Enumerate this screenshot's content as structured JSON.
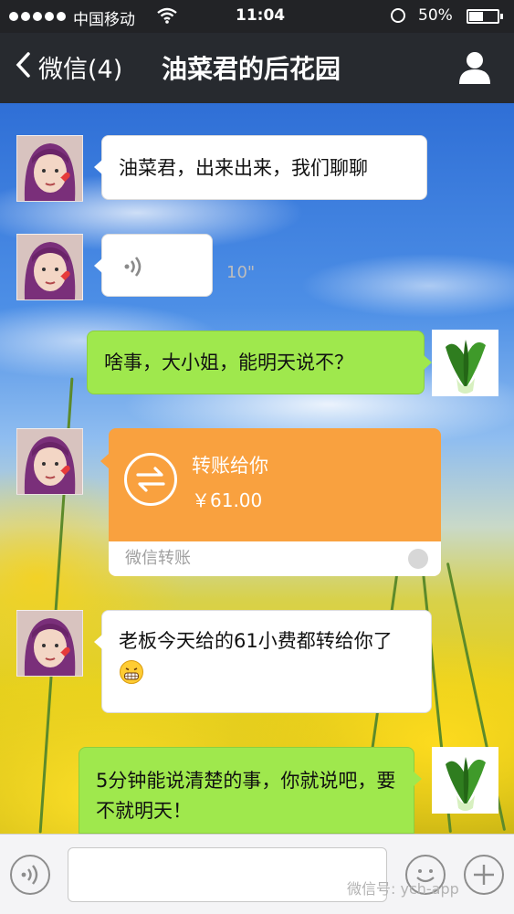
{
  "status_bar": {
    "carrier": "中国移动",
    "time": "11:04",
    "battery": "50%",
    "battery_level": 0.5
  },
  "nav": {
    "back_label": "微信(4)",
    "title": "油菜君的后花园",
    "back_icon": "chevron-left-icon",
    "profile_icon": "person-icon"
  },
  "messages": [
    {
      "side": "left",
      "type": "text",
      "text": "油菜君，出来出来，我们聊聊"
    },
    {
      "side": "left",
      "type": "voice",
      "duration": "10\""
    },
    {
      "side": "right",
      "type": "text",
      "text": "啥事，大小姐，能明天说不？"
    },
    {
      "side": "left",
      "type": "transfer",
      "title": "转账给你",
      "amount": "￥61.00",
      "footer": "微信转账"
    },
    {
      "side": "left",
      "type": "text",
      "text": "老板今天给的61小费都转给你了"
    },
    {
      "side": "right",
      "type": "text",
      "text": "5分钟能说清楚的事，你就说吧，要不就明天！"
    }
  ],
  "input_bar": {
    "placeholder": "",
    "voice_icon": "voice-icon",
    "emoji_icon": "emoji-icon",
    "plus_icon": "plus-icon"
  },
  "watermark": "微信号: ych-app",
  "colors": {
    "nav_bg": "#272a2f",
    "green_bubble": "#9fe84d",
    "transfer_orange": "#f9a13f"
  }
}
